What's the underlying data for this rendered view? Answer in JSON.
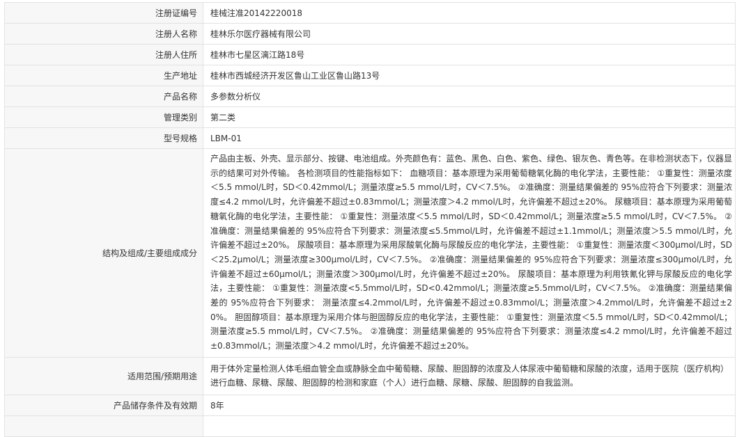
{
  "rows": [
    {
      "label": "注册证编号",
      "value": "桂械注准20142220018"
    },
    {
      "label": "注册人名称",
      "value": "桂林乐尔医疗器械有限公司"
    },
    {
      "label": "注册人住所",
      "value": "桂林市七星区漓江路18号"
    },
    {
      "label": "生产地址",
      "value": "桂林市西城经济开发区鲁山工业区鲁山路13号"
    },
    {
      "label": "产品名称",
      "value": "多参数分析仪"
    },
    {
      "label": "管理类别",
      "value": "第二类"
    },
    {
      "label": "型号规格",
      "value": "LBM-01"
    },
    {
      "label": "结构及组成/主要组成成分",
      "value": "产品由主板、外壳、显示部分、按键、电池组成。外壳颜色有：蓝色、黑色、白色、紫色、绿色、银灰色、青色等。在非检测状态下，仪器显示的结果可对外传输。 各检测项目的性能指标如下： 血糖项目：基本原理为采用葡萄糖氧化酶的电化学法，主要性能： ①重复性：测量浓度＜5.5 mmol/L时，SD＜0.42mmol/L；测量浓度≥5.5 mmol/L时，CV＜7.5%。 ②准确度：测量结果偏差的 95%应符合下列要求：测量浓度≤4.2 mmol/L时，允许偏差不超过±0.83mmol/L；测量浓度＞4.2 mmol/L时，允许偏差不超过±20%。 尿糖项目：基本原理为采用葡萄糖氧化酶的电化学法，主要性能： ①重复性：测量浓度＜5.5 mmol/L时，SD＜0.42mmol/L；测量浓度≥5.5 mmol/L时，CV＜7.5%。 ②准确度：测量结果偏差的 95%应符合下列要求：测量浓度≤5.5mmol/L时，允许偏差不超过±1.1mmol/L；测量浓度＞5.5 mmol/L时，允许偏差不超过±20%。 尿酸项目：基本原理为采用尿酸氧化酶与尿酸反应的电化学法，主要性能： ①重复性：测量浓度＜300μmol/L时，SD＜25.2μmol/L；测量浓度≥300μmol/L时，CV＜7.5%。 ②准确度：测量结果偏差的 95%应符合下列要求：测量浓度≤300μmol/L时，允许偏差不超过±60μmol/L；测量浓度＞300μmol/L时，允许偏差不超过±20%。 尿酸项目：基本原理为利用铁氰化钾与尿酸反应的电化学法，主要性能： ①重复性：测量浓度<5.5mmol/L时，SD<0.42mmol/L；测量浓度≥5.5mmol/L时，CV＜7.5%。 ②准确度：测量结果偏差的 95%应符合下列要求： 测量浓度≤4.2mmol/L时，允许偏差不超过±0.83mmol/L；测量浓度＞4.2mmol/L时，允许偏差不超过±20%。 胆固醇项目：基本原理为采用介体与胆固醇反应的电化学法，主要性能： ①重复性：测量浓度＜5.5 mmol/L时，SD＜0.42mmol/L；测量浓度≥5.5 mmol/L时，CV＜7.5%。 ②准确度：测量结果偏差的 95%应符合下列要求：测量浓度≤4.2 mmol/L时，允许偏差不超过±0.83mmol/L；测量浓度＞4.2 mmol/L时，允许偏差不超过±20%。"
    },
    {
      "label": "适用范围/预期用途",
      "value": "用于体外定量检测人体毛细血管全血或静脉全血中葡萄糖、尿酸、胆固醇的浓度及人体尿液中葡萄糖和尿酸的浓度，适用于医院（医疗机构）进行血糖、尿糖、尿酸、胆固醇的检测和家庭（个人）进行血糖、尿糖、尿酸、胆固醇的自我监测。"
    },
    {
      "label": "产品储存条件及有效期",
      "value": "8年"
    },
    {
      "label": "",
      "value": ""
    }
  ]
}
